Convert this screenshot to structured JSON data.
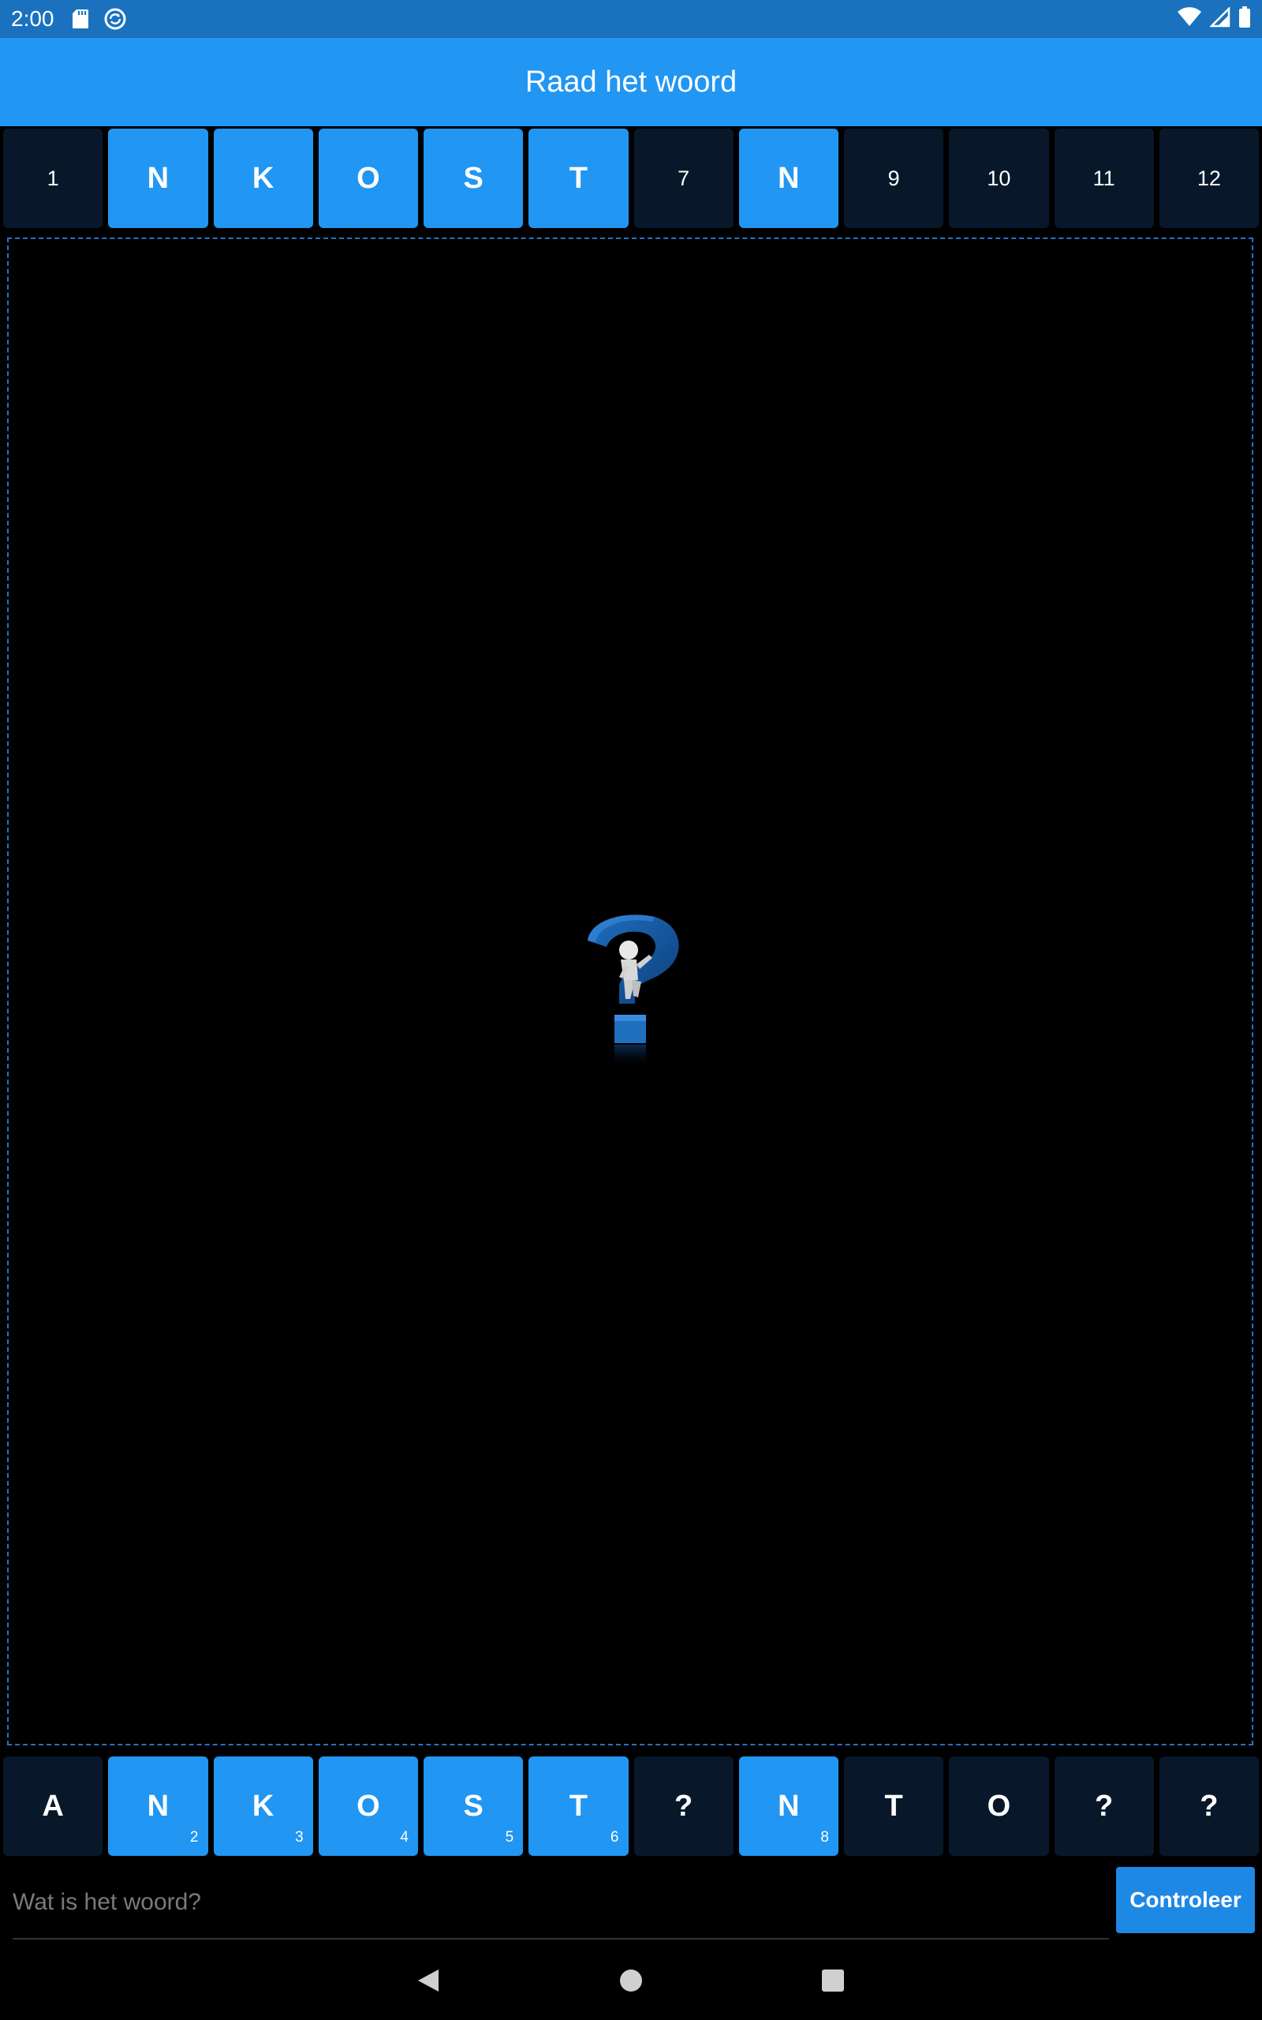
{
  "status_bar": {
    "time": "2:00",
    "icons": [
      "sd-card-icon",
      "sync-icon",
      "wifi-icon",
      "signal-icon",
      "battery-icon"
    ]
  },
  "app_bar": {
    "title": "Raad het woord"
  },
  "top_tiles": [
    {
      "text": "1",
      "revealed": false
    },
    {
      "text": "N",
      "revealed": true
    },
    {
      "text": "K",
      "revealed": true
    },
    {
      "text": "O",
      "revealed": true
    },
    {
      "text": "S",
      "revealed": true
    },
    {
      "text": "T",
      "revealed": true
    },
    {
      "text": "7",
      "revealed": false
    },
    {
      "text": "N",
      "revealed": true
    },
    {
      "text": "9",
      "revealed": false
    },
    {
      "text": "10",
      "revealed": false
    },
    {
      "text": "11",
      "revealed": false
    },
    {
      "text": "12",
      "revealed": false
    }
  ],
  "image": {
    "icon": "question-mark-figure-icon"
  },
  "bottom_tiles": [
    {
      "letter": "A",
      "sub": "",
      "revealed": false
    },
    {
      "letter": "N",
      "sub": "2",
      "revealed": true
    },
    {
      "letter": "K",
      "sub": "3",
      "revealed": true
    },
    {
      "letter": "O",
      "sub": "4",
      "revealed": true
    },
    {
      "letter": "S",
      "sub": "5",
      "revealed": true
    },
    {
      "letter": "T",
      "sub": "6",
      "revealed": true
    },
    {
      "letter": "?",
      "sub": "",
      "revealed": false
    },
    {
      "letter": "N",
      "sub": "8",
      "revealed": true
    },
    {
      "letter": "T",
      "sub": "",
      "revealed": false
    },
    {
      "letter": "O",
      "sub": "",
      "revealed": false
    },
    {
      "letter": "?",
      "sub": "",
      "revealed": false
    },
    {
      "letter": "?",
      "sub": "",
      "revealed": false
    }
  ],
  "answer": {
    "placeholder": "Wat is het woord?",
    "value": "",
    "button_label": "Controleer"
  },
  "nav_bar": {
    "icons": [
      "back-icon",
      "home-icon",
      "recents-icon"
    ]
  },
  "colors": {
    "status_bar": "#1a72bf",
    "app_bar": "#2196f3",
    "tile_revealed": "#2196f3",
    "tile_hidden": "#08182a",
    "button": "#1e88e5"
  }
}
